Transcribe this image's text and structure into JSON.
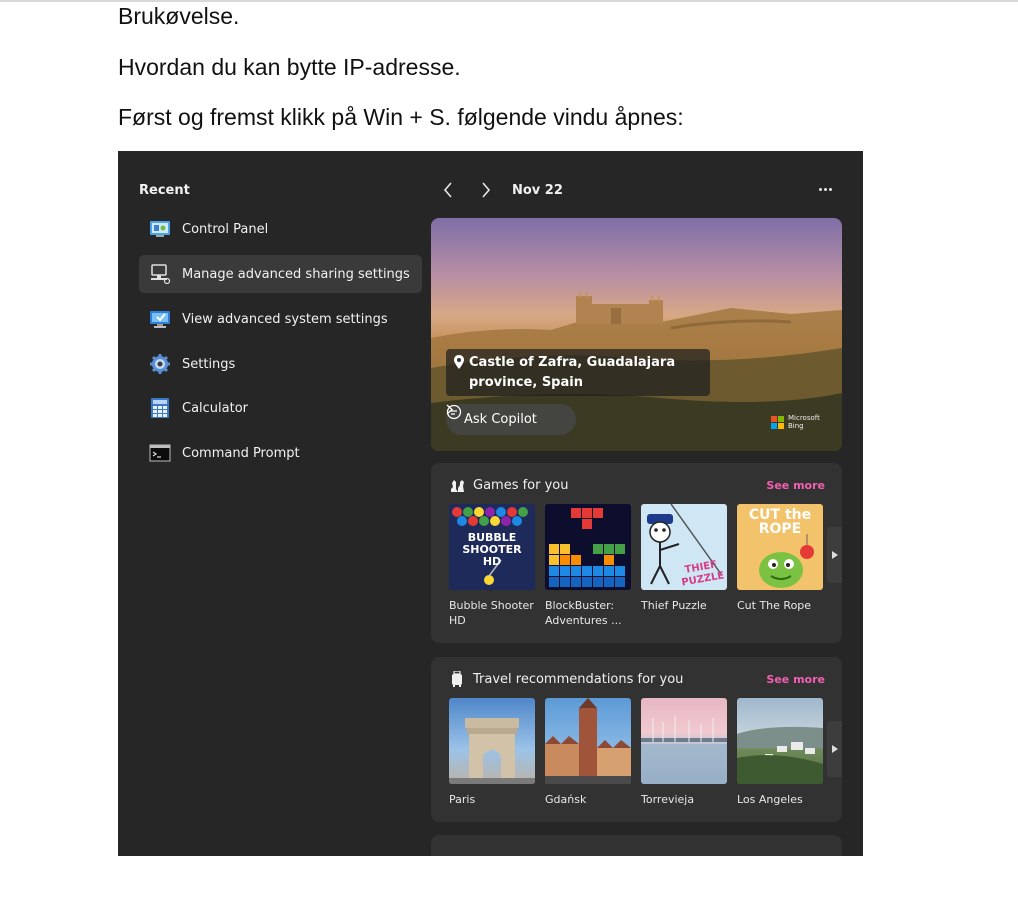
{
  "document": {
    "paragraphs": [
      "Brukøvelse.",
      "Hvordan du kan bytte IP-adresse.",
      "Først og fremst klikk på Win + S. følgende vindu åpnes:"
    ]
  },
  "search_panel": {
    "recent": {
      "title": "Recent",
      "items": [
        {
          "label": "Control Panel",
          "icon": "control-panel-icon",
          "selected": false
        },
        {
          "label": "Manage advanced sharing settings",
          "icon": "network-computer-icon",
          "selected": true
        },
        {
          "label": "View advanced system settings",
          "icon": "monitor-check-icon",
          "selected": false
        },
        {
          "label": "Settings",
          "icon": "gear-icon",
          "selected": false
        },
        {
          "label": "Calculator",
          "icon": "calculator-icon",
          "selected": false
        },
        {
          "label": "Command Prompt",
          "icon": "terminal-icon",
          "selected": false
        }
      ]
    },
    "header": {
      "date": "Nov 22"
    },
    "hero": {
      "location": "Castle of Zafra, Guadalajara province, Spain",
      "copilot_label": "Ask Copilot",
      "brand_text": "Microsoft Bing"
    },
    "games": {
      "title": "Games for you",
      "see_more": "See more",
      "items": [
        {
          "label": "Bubble Shooter HD",
          "thumb_text": "BUBBLE SHOOTER HD"
        },
        {
          "label": "BlockBuster: Adventures ..."
        },
        {
          "label": "Thief Puzzle",
          "thumb_text": "THIEF PUZZLE"
        },
        {
          "label": "Cut The Rope",
          "thumb_text": "CUT the ROPE"
        }
      ]
    },
    "travel": {
      "title": "Travel recommendations for you",
      "see_more": "See more",
      "items": [
        {
          "label": "Paris"
        },
        {
          "label": "Gdańsk"
        },
        {
          "label": "Torrevieja"
        },
        {
          "label": "Los Angeles"
        }
      ]
    }
  },
  "colors": {
    "panel_bg": "#262626",
    "card_bg": "#323232",
    "accent_pink": "#f45fb2",
    "selected_bg": "#3a3a3a"
  }
}
